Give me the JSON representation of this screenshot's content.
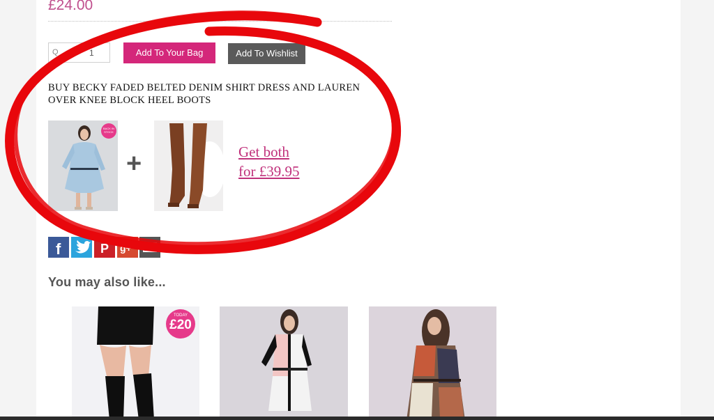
{
  "product": {
    "price": "£24.00",
    "quantity_label": "Q",
    "quantity_value": "1",
    "add_to_bag_label": "Add To Your Bag",
    "add_to_wishlist_label": "Add To Wishlist"
  },
  "bundle": {
    "title": "BUY BECKY FADED BELTED DENIM SHIRT DRESS AND LAUREN OVER KNEE BLOCK HEEL BOOTS",
    "badge_text": "BACK IN STOCK",
    "offer_line1": "Get both",
    "offer_line2": "for £39.95"
  },
  "social": [
    {
      "name": "facebook",
      "glyph": "f"
    },
    {
      "name": "twitter",
      "glyph": "t"
    },
    {
      "name": "pinterest",
      "glyph": "P"
    },
    {
      "name": "google-plus",
      "glyph": "g+"
    },
    {
      "name": "email",
      "glyph": "✉"
    }
  ],
  "also_like": {
    "heading": "You may also like...",
    "badge_small": "TODAY",
    "badge_price": "£20"
  },
  "colors": {
    "accent_pink": "#d4277a",
    "price_pink": "#c0508e",
    "annotation_red": "#e8070c"
  }
}
